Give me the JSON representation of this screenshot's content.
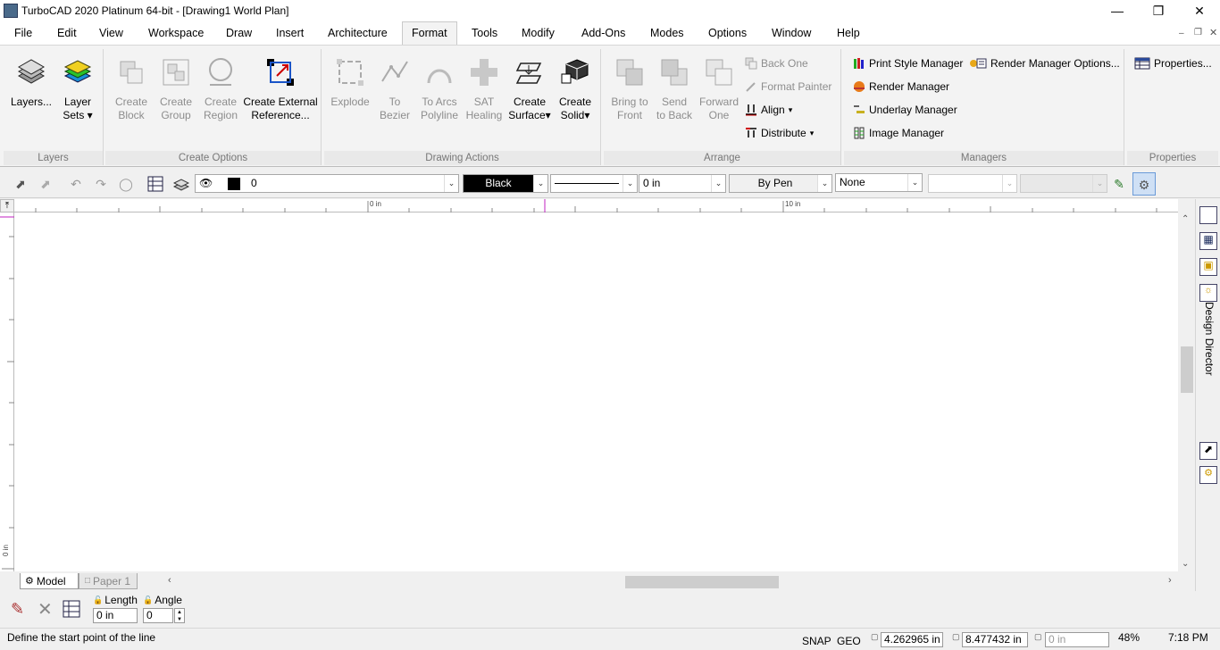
{
  "window": {
    "title": "TurboCAD 2020 Platinum 64-bit - [Drawing1 World Plan]"
  },
  "menus": [
    "File",
    "Edit",
    "View",
    "Workspace",
    "Draw",
    "Insert",
    "Architecture",
    "Format",
    "Tools",
    "Modify",
    "Add-Ons",
    "Modes",
    "Options",
    "Window",
    "Help"
  ],
  "active_menu": "Format",
  "ribbon": {
    "layers": {
      "label": "Layers",
      "layers_btn": "Layers...",
      "layer_sets_1": "Layer",
      "layer_sets_2": "Sets"
    },
    "create_options": {
      "label": "Create Options",
      "block_1": "Create",
      "block_2": "Block",
      "group_1": "Create",
      "group_2": "Group",
      "region_1": "Create",
      "region_2": "Region",
      "xref_1": "Create External",
      "xref_2": "Reference..."
    },
    "drawing_actions": {
      "label": "Drawing Actions",
      "explode": "Explode",
      "bezier_1": "To",
      "bezier_2": "Bezier",
      "arcs_1": "To Arcs",
      "arcs_2": "Polyline",
      "sat_1": "SAT",
      "sat_2": "Healing",
      "surface_1": "Create",
      "surface_2": "Surface",
      "solid_1": "Create",
      "solid_2": "Solid"
    },
    "arrange": {
      "label": "Arrange",
      "front_1": "Bring to",
      "front_2": "Front",
      "back_1": "Send",
      "back_2": "to Back",
      "fwd_1": "Forward",
      "fwd_2": "One",
      "back_one": "Back One",
      "format_painter": "Format Painter",
      "align": "Align",
      "distribute": "Distribute"
    },
    "managers": {
      "label": "Managers",
      "print_style": "Print Style Manager",
      "render_mgr": "Render Manager",
      "underlay": "Underlay Manager",
      "image_mgr": "Image Manager",
      "render_opts": "Render Manager Options..."
    },
    "properties": {
      "label": "Properties",
      "props_btn": "Properties..."
    }
  },
  "toolbar": {
    "layer_value": "0",
    "color_value": "Black",
    "thickness_value": "0 in",
    "pen_value": "By Pen",
    "fill_value": "None"
  },
  "ruler": {
    "mark_0": "0 in",
    "mark_10": "10 in",
    "v_label": "0 in"
  },
  "tabs": {
    "model": "Model",
    "paper1": "Paper 1"
  },
  "inputbar": {
    "length_label": "Length",
    "angle_label": "Angle",
    "length_value": "0 in",
    "angle_value": "0"
  },
  "side_panel": {
    "label": "Design Director"
  },
  "status": {
    "prompt": "Define the start point of the line",
    "snap": "SNAP",
    "geo": "GEO",
    "x": "4.262965 in",
    "y": "8.477432 in",
    "z": "0 in",
    "zoom": "48%",
    "time": "7:18 PM"
  }
}
